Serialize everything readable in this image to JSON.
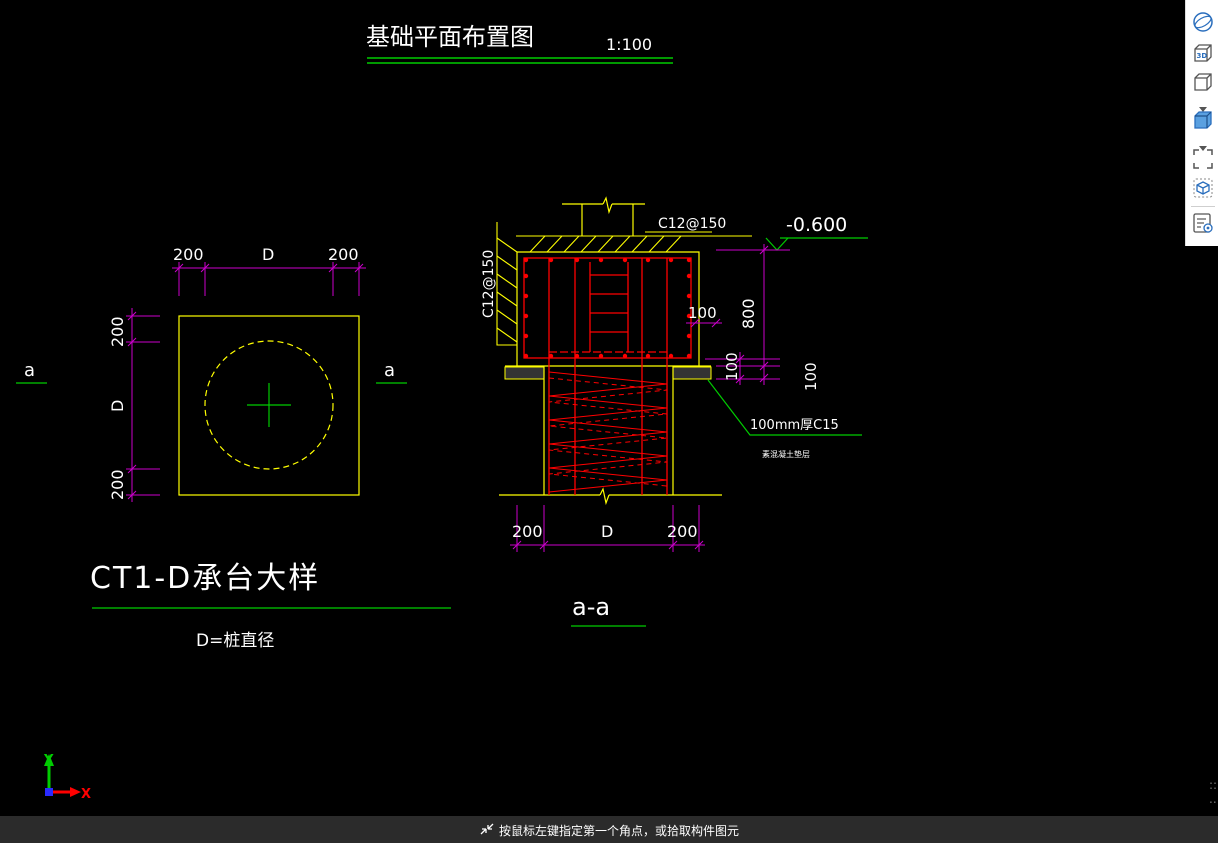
{
  "drawing": {
    "title": "基础平面布置图",
    "title_scale": "1:100",
    "plan": {
      "dim_top_left": "200",
      "dim_top_mid": "D",
      "dim_top_right": "200",
      "dim_left_top": "200",
      "dim_left_mid": "D",
      "dim_left_bottom": "200",
      "section_mark_left": "a",
      "section_mark_right": "a"
    },
    "detail_title": "CT1-D承台大样",
    "detail_note": "D=桩直径",
    "section": {
      "rebar_top": "C12@150",
      "rebar_side": "C12@150",
      "elevation": "-0.600",
      "dim_800": "800",
      "dim_100_a": "100",
      "dim_100_b": "100",
      "dim_100_c": "100",
      "cushion_note": "100mm厚C15",
      "cushion_note_sub": "素混凝土垫层",
      "dim_bottom_left": "200",
      "dim_bottom_mid": "D",
      "dim_bottom_right": "200",
      "section_title": "a-a"
    },
    "axis": {
      "y_label": "Y",
      "x_label": "X"
    }
  },
  "toolbar": {
    "icons": [
      "sphere-view-icon",
      "3d-view-icon",
      "cube-view-icon",
      "shaded-cube-icon",
      "fullscreen-icon",
      "component-icon",
      "properties-icon"
    ]
  },
  "statusbar": {
    "prompt": "按鼠标左键指定第一个角点，或拾取构件图元"
  },
  "colors": {
    "background": "#000000",
    "cad_yellow": "#ffff00",
    "cad_magenta": "#cc00cc",
    "cad_red": "#ff0000",
    "cad_green": "#00cc00",
    "cad_white": "#ffffff",
    "statusbar": "#2b2b2b"
  }
}
